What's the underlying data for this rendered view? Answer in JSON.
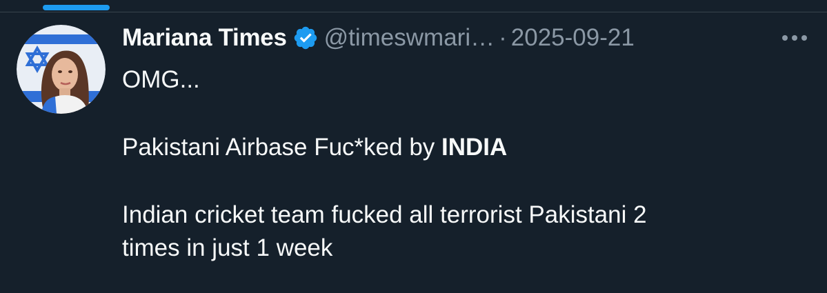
{
  "tweet": {
    "author": {
      "display_name": "Mariana Times",
      "handle": "@timeswmari…",
      "verified": true,
      "avatar_icon": "profile-photo-flag"
    },
    "separator": "·",
    "timestamp": "2025-09-21",
    "more_icon": "more-horizontal-icon",
    "body": {
      "line1": "OMG...",
      "line2_prefix": "Pakistani Airbase Fuc*ked by ",
      "line2_bold": "INDIA",
      "line3_a": "Indian cricket team fucked all terrorist Pakistani 2",
      "line3_b": "times in just 1 week"
    }
  },
  "colors": {
    "background": "#15202b",
    "text_primary": "#f7f9f9",
    "text_secondary": "#8b98a5",
    "accent": "#1d9bf0",
    "divider": "#38444d"
  }
}
